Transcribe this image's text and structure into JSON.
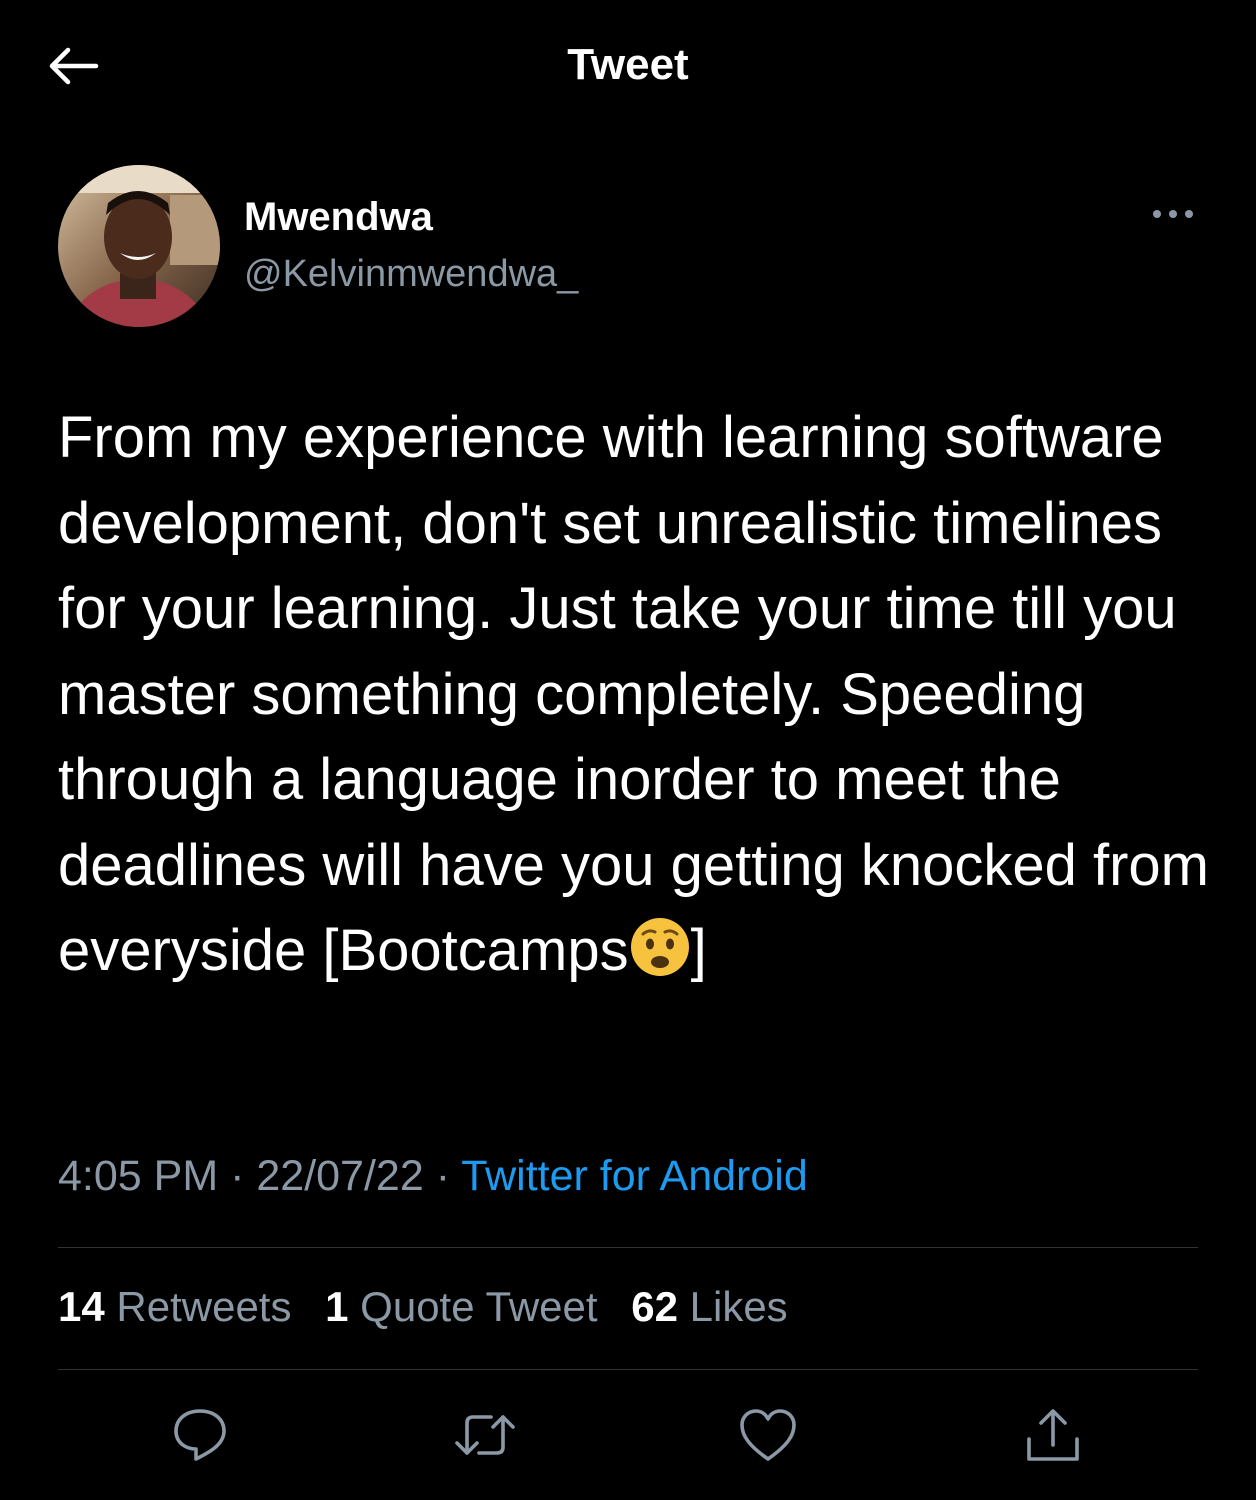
{
  "header": {
    "title": "Tweet",
    "back_icon": "arrow-left-icon"
  },
  "author": {
    "display_name": "Mwendwa",
    "handle": "@Kelvinmwendwa_",
    "more_icon": "more-dots-icon"
  },
  "tweet": {
    "text": "From my experience with learning software development, don't set unrealistic timelines for your learning. Just take your time till you master something completely. Speeding through a language inorder to meet the deadlines will have you getting knocked from everyside [Bootcamps",
    "text_suffix": "]",
    "emoji_icon": "anxious-face-emoji"
  },
  "meta": {
    "time": "4:05 PM",
    "separator": " · ",
    "date": "22/07/22",
    "source": "Twitter for Android"
  },
  "stats": {
    "retweets_count": "14",
    "retweets_label": "Retweets",
    "quotes_count": "1",
    "quotes_label": "Quote Tweet",
    "likes_count": "62",
    "likes_label": "Likes"
  },
  "actions": [
    {
      "name": "reply",
      "icon": "reply-icon"
    },
    {
      "name": "retweet",
      "icon": "retweet-icon"
    },
    {
      "name": "like",
      "icon": "heart-icon"
    },
    {
      "name": "share",
      "icon": "share-icon"
    }
  ],
  "colors": {
    "background": "#000000",
    "text": "#ffffff",
    "secondary": "#8b98a5",
    "link": "#1d9bf0",
    "divider": "#2f3336"
  }
}
